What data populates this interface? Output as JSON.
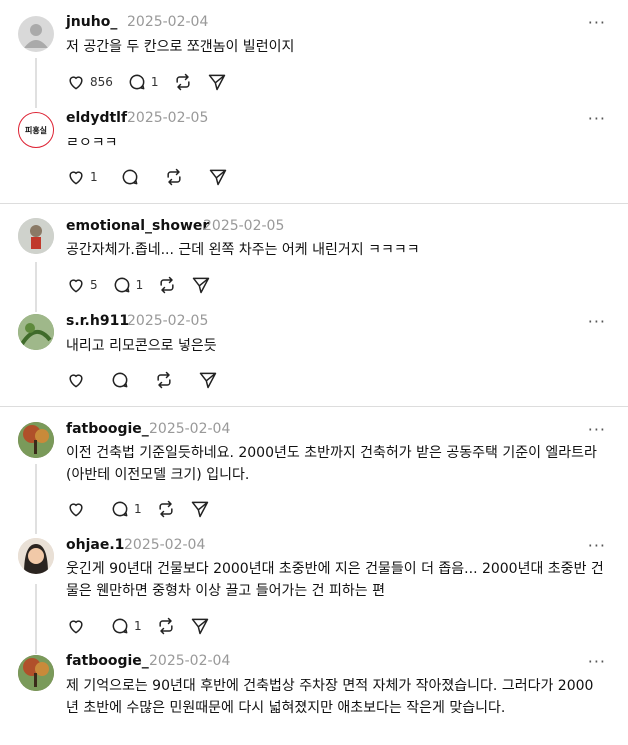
{
  "posts": [
    {
      "user": "jnuho_",
      "date": "2025-02-04",
      "text": "저 공간을 두 칸으로 쪼갠놈이 빌런이지",
      "likes": "856",
      "replies": "1",
      "avatar": "default-avatar"
    },
    {
      "user": "eldydtlf",
      "date": "2025-02-05",
      "text": "ㄹㅇㅋㅋ",
      "likes": "1",
      "replies": "",
      "avatar": "logo-avatar",
      "avatar_text": "피홍실"
    },
    {
      "user": "emotional_shower",
      "date": "2025-02-05",
      "text": "공간자체가.좁네... 근데 왼쪽 차주는 어케 내린거지 ㅋㅋㅋㅋ",
      "likes": "5",
      "replies": "1",
      "avatar": "character-avatar"
    },
    {
      "user": "s.r.h911",
      "date": "2025-02-05",
      "text": "내리고 리모콘으로 넣은듯",
      "likes": "",
      "replies": "",
      "avatar": "plant-avatar"
    },
    {
      "user": "fatboogie_",
      "date": "2025-02-04",
      "text": "이전 건축법 기준일듯하네요. 2000년도 초반까지 건축허가 받은 공동주택 기준이 엘라트라(아반테 이전모델 크기) 입니다.",
      "likes": "",
      "replies": "1",
      "avatar": "tree-avatar"
    },
    {
      "user": "ohjae.1",
      "date": "2025-02-04",
      "text": "웃긴게 90년대 건물보다 2000년대 초중반에 지은 건물들이 더 좁음... 2000년대 초중반 건물은 웬만하면 중형차 이상 끌고 들어가는 건 피하는 편",
      "likes": "",
      "replies": "1",
      "avatar": "person-avatar"
    },
    {
      "user": "fatboogie_",
      "date": "2025-02-04",
      "text": "제 기억으로는 90년대 후반에 건축법상 주차장 면적 자체가 작아졌습니다. 그러다가 2000년 초반에 수많은 민원때문에 다시 넓혀졌지만 애초보다는 작은게 맞습니다.",
      "likes": "",
      "replies": "",
      "avatar": "tree-avatar"
    }
  ],
  "menu_glyph": "···",
  "colors": {
    "text": "#111111",
    "muted": "#999999",
    "divider": "#dddddd",
    "thread": "#e0e0e0"
  }
}
